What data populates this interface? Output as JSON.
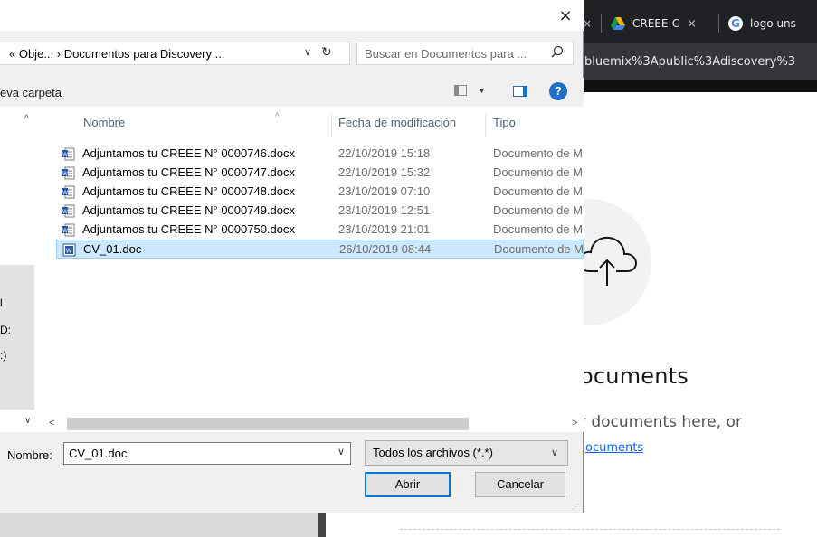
{
  "browser": {
    "tabs": [
      {
        "label": "CREEE-C",
        "close": "×",
        "icon": "google-drive-icon"
      },
      {
        "label": "logo uns",
        "icon": "google-icon"
      }
    ],
    "partial_tab_close": "×",
    "url_fragment": "bluemix%3Apublic%3Adiscovery%3"
  },
  "page": {
    "title": "ocuments",
    "subtitle": "r documents here, or",
    "link": "ocuments",
    "icon": "cloud-upload-icon"
  },
  "dialog": {
    "close": "×",
    "address": {
      "path": "« Obje...  ›  Documentos para Discovery ...",
      "chevron": "∨",
      "refresh": "↻"
    },
    "search_placeholder": "Buscar en Documentos para ...",
    "search_icon": "⚲",
    "toolbar": {
      "new_folder": "eva carpeta",
      "help": "?"
    },
    "nav": {
      "labels": [
        "l",
        "D:",
        ":)"
      ],
      "up": "^",
      "down": "∨"
    },
    "columns": {
      "name": "Nombre",
      "date": "Fecha de modificación",
      "type": "Tipo",
      "sort": "^"
    },
    "files": [
      {
        "name": "Adjuntamos tu CREEE N° 0000746.docx",
        "date": "22/10/2019 15:18",
        "type": "Documento de M",
        "icon": "word-docx-icon",
        "selected": false
      },
      {
        "name": "Adjuntamos tu CREEE N° 0000747.docx",
        "date": "22/10/2019 15:32",
        "type": "Documento de M",
        "icon": "word-docx-icon",
        "selected": false
      },
      {
        "name": "Adjuntamos tu CREEE N° 0000748.docx",
        "date": "23/10/2019 07:10",
        "type": "Documento de M",
        "icon": "word-docx-icon",
        "selected": false
      },
      {
        "name": "Adjuntamos tu CREEE N° 0000749.docx",
        "date": "23/10/2019 12:51",
        "type": "Documento de M",
        "icon": "word-docx-icon",
        "selected": false
      },
      {
        "name": "Adjuntamos tu CREEE N° 0000750.docx",
        "date": "23/10/2019 21:01",
        "type": "Documento de M",
        "icon": "word-docx-icon",
        "selected": false
      },
      {
        "name": "CV_01.doc",
        "date": "26/10/2019 08:44",
        "type": "Documento de M",
        "icon": "word-doc-icon",
        "selected": true
      }
    ],
    "hscroll": {
      "left": "<",
      "right": ">"
    },
    "filename_label": "Nombre:",
    "filename_value": "CV_01.doc",
    "filename_chevron": "∨",
    "filter": {
      "value": "Todos los archivos (*.*)",
      "chevron": "∨"
    },
    "buttons": {
      "open": "Abrir",
      "cancel": "Cancelar"
    }
  },
  "colors": {
    "selection": "#cce8ff",
    "accent": "#0078d7",
    "link": "#0f62fe"
  }
}
